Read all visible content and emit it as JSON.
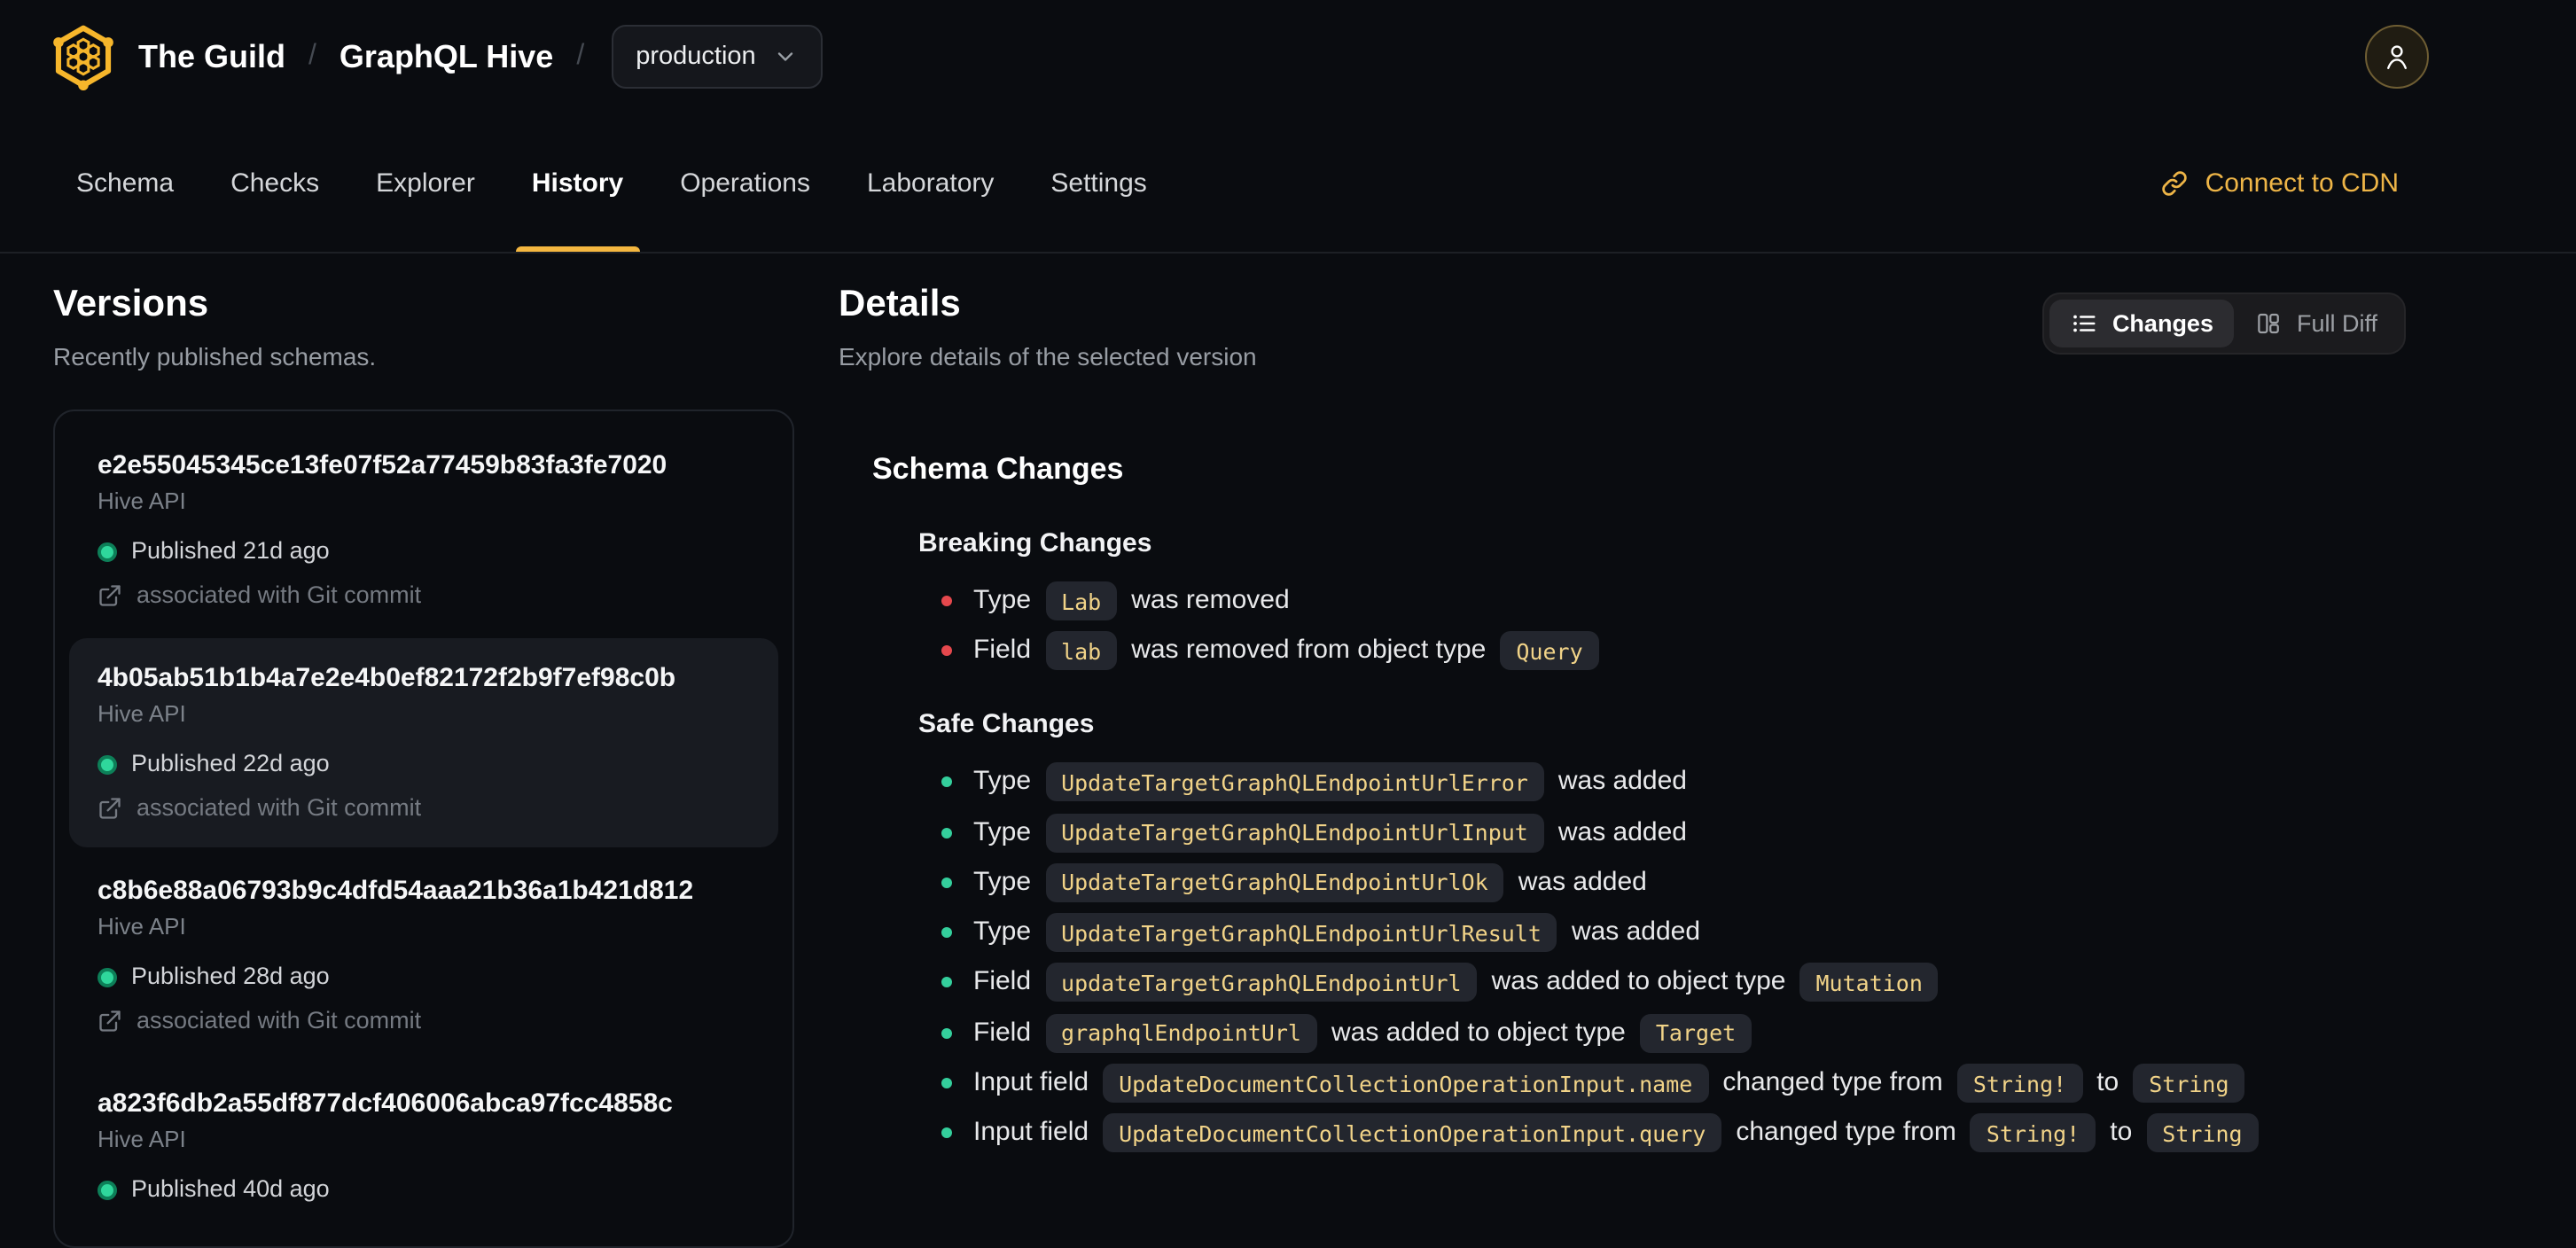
{
  "header": {
    "org": "The Guild",
    "separator": "/",
    "project": "GraphQL Hive",
    "target_selector": {
      "value": "production"
    },
    "tabs": [
      {
        "label": "Schema",
        "active": false
      },
      {
        "label": "Checks",
        "active": false
      },
      {
        "label": "Explorer",
        "active": false
      },
      {
        "label": "History",
        "active": true
      },
      {
        "label": "Operations",
        "active": false
      },
      {
        "label": "Laboratory",
        "active": false
      },
      {
        "label": "Settings",
        "active": false
      }
    ],
    "connect_cdn_label": "Connect to CDN"
  },
  "versions": {
    "title": "Versions",
    "subtitle": "Recently published schemas.",
    "items": [
      {
        "hash": "e2e55045345ce13fe07f52a77459b83fa3fe7020",
        "service": "Hive API",
        "published": "Published 21d ago",
        "git": "associated with Git commit",
        "selected": false
      },
      {
        "hash": "4b05ab51b1b4a7e2e4b0ef82172f2b9f7ef98c0b",
        "service": "Hive API",
        "published": "Published 22d ago",
        "git": "associated with Git commit",
        "selected": true
      },
      {
        "hash": "c8b6e88a06793b9c4dfd54aaa21b36a1b421d812",
        "service": "Hive API",
        "published": "Published 28d ago",
        "git": "associated with Git commit",
        "selected": false
      },
      {
        "hash": "a823f6db2a55df877dcf406006abca97fcc4858c",
        "service": "Hive API",
        "published": "Published 40d ago",
        "git": null,
        "selected": false
      }
    ]
  },
  "details": {
    "title": "Details",
    "subtitle": "Explore details of the selected version",
    "view_toggle": {
      "changes_label": "Changes",
      "full_diff_label": "Full Diff",
      "active": "changes"
    },
    "schema_changes_title": "Schema Changes",
    "breaking": {
      "title": "Breaking Changes",
      "items": [
        [
          {
            "text": "Type"
          },
          {
            "code": "Lab"
          },
          {
            "text": "was removed"
          }
        ],
        [
          {
            "text": "Field"
          },
          {
            "code": "lab"
          },
          {
            "text": "was removed from object type"
          },
          {
            "code": "Query"
          }
        ]
      ]
    },
    "safe": {
      "title": "Safe Changes",
      "items": [
        [
          {
            "text": "Type"
          },
          {
            "code": "UpdateTargetGraphQLEndpointUrlError"
          },
          {
            "text": "was added"
          }
        ],
        [
          {
            "text": "Type"
          },
          {
            "code": "UpdateTargetGraphQLEndpointUrlInput"
          },
          {
            "text": "was added"
          }
        ],
        [
          {
            "text": "Type"
          },
          {
            "code": "UpdateTargetGraphQLEndpointUrlOk"
          },
          {
            "text": "was added"
          }
        ],
        [
          {
            "text": "Type"
          },
          {
            "code": "UpdateTargetGraphQLEndpointUrlResult"
          },
          {
            "text": "was added"
          }
        ],
        [
          {
            "text": "Field"
          },
          {
            "code": "updateTargetGraphQLEndpointUrl"
          },
          {
            "text": "was added to object type"
          },
          {
            "code": "Mutation"
          }
        ],
        [
          {
            "text": "Field"
          },
          {
            "code": "graphqlEndpointUrl"
          },
          {
            "text": "was added to object type"
          },
          {
            "code": "Target"
          }
        ],
        [
          {
            "text": "Input field"
          },
          {
            "code": "UpdateDocumentCollectionOperationInput.name"
          },
          {
            "text": "changed type from"
          },
          {
            "code": "String!"
          },
          {
            "text": "to"
          },
          {
            "code": "String"
          }
        ],
        [
          {
            "text": "Input field"
          },
          {
            "code": "UpdateDocumentCollectionOperationInput.query"
          },
          {
            "text": "changed type from"
          },
          {
            "code": "String!"
          },
          {
            "text": "to"
          },
          {
            "code": "String"
          }
        ]
      ]
    }
  },
  "colors": {
    "background": "#0a0c10",
    "accent_gold": "#f4b740",
    "logo_gold": "#f6b62b",
    "cdn_link": "#eeb547",
    "breaking_bullet": "#e5484d",
    "safe_bullet": "#34cf9c",
    "published_dot": "#2fd79c",
    "code_chip_text": "#f1d388",
    "code_chip_bg": "#23262e"
  }
}
